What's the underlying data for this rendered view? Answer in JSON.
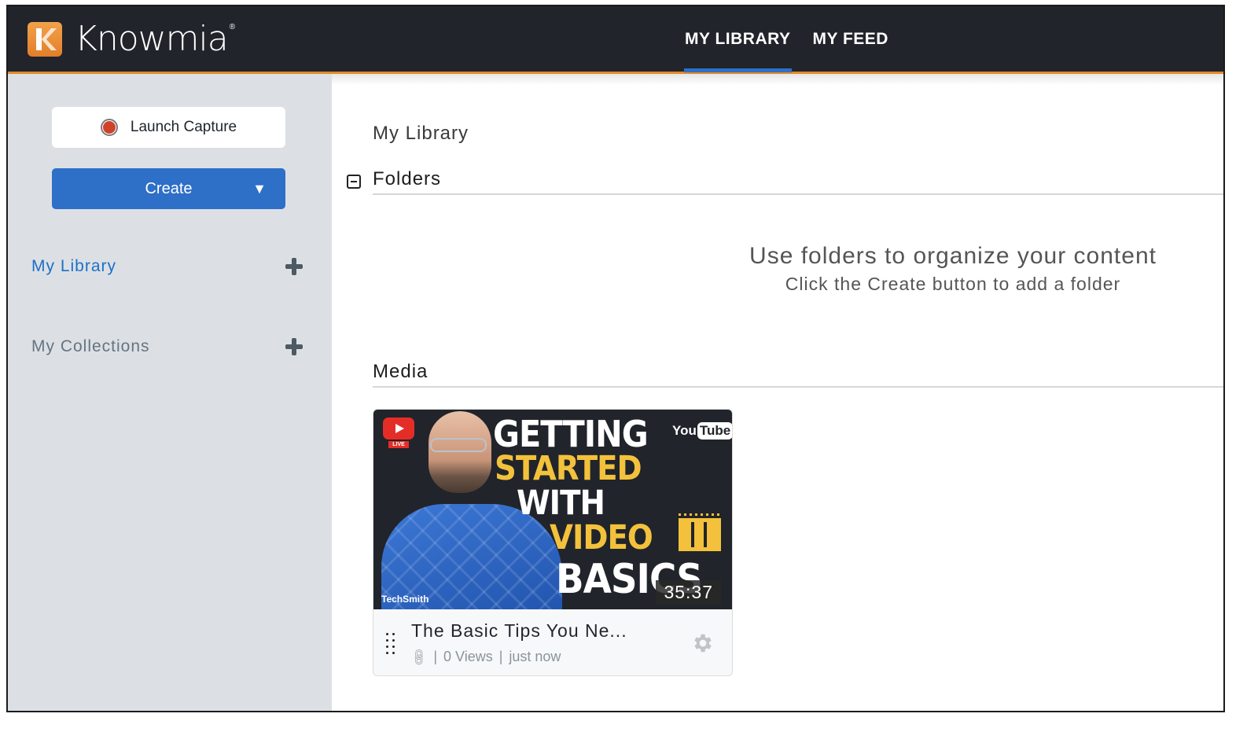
{
  "app": {
    "brand": "Knowmia",
    "brand_mark": "®",
    "logo_letter": "K",
    "colors": {
      "topbar": "#21242b",
      "accent_orange": "#e08a2a",
      "primary_blue": "#2e6fc7",
      "sidebar_bg": "#dce0e5",
      "record_red": "#d0412c"
    }
  },
  "nav": {
    "tabs": [
      {
        "label": "MY LIBRARY",
        "active": true
      },
      {
        "label": "MY FEED",
        "active": false
      }
    ]
  },
  "sidebar": {
    "launch_capture_label": "Launch Capture",
    "create_label": "Create",
    "create_caret": "▼",
    "items": [
      {
        "label": "My Library",
        "active": true,
        "action_icon": "plus-icon"
      },
      {
        "label": "My Collections",
        "active": false,
        "action_icon": "plus-icon"
      }
    ]
  },
  "main": {
    "page_title": "My Library",
    "folders": {
      "title": "Folders",
      "collapse_icon": "minus-square-icon",
      "empty_title": "Use folders to organize your content",
      "empty_subtitle": "Click the Create button to add a folder"
    },
    "media": {
      "title": "Media",
      "items": [
        {
          "title": "The Basic Tips You Ne...",
          "link_icon": "link-icon",
          "separator": "|",
          "views": "0 Views",
          "time": "just now",
          "duration": "35:37",
          "thumbnail": {
            "lines": [
              "GETTING",
              "STARTED",
              "WITH",
              "VIDEO",
              "BASICS"
            ],
            "badge_live": "LIVE",
            "youtube_you": "You",
            "youtube_tube": "Tube",
            "watermark": "TechSmith"
          }
        }
      ]
    }
  }
}
